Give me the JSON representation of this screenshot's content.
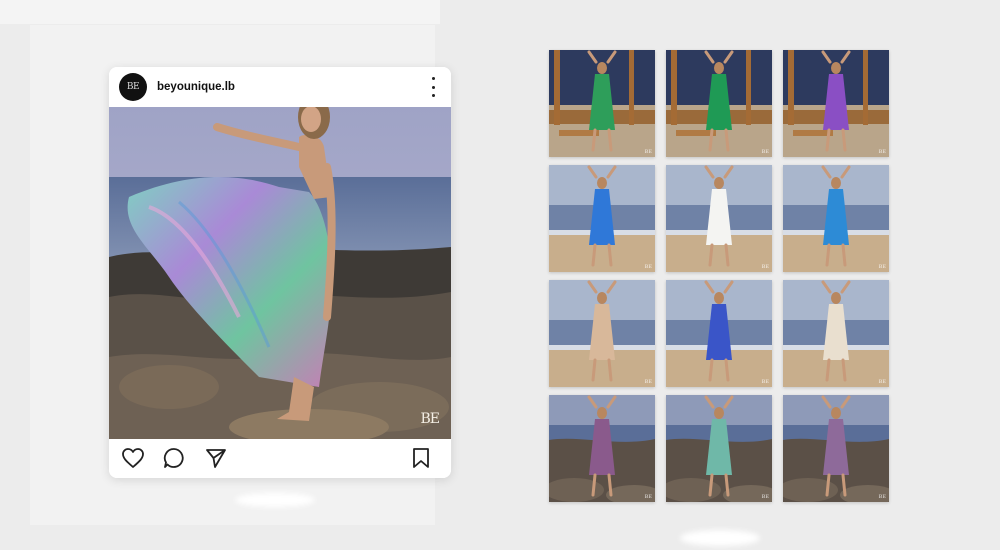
{
  "post": {
    "avatar_text": "BE",
    "username": "beyounique.lb",
    "watermark": "BE",
    "actions": [
      "heart-icon",
      "comment-icon",
      "share-icon",
      "bookmark-icon"
    ]
  },
  "grid": {
    "rows": 4,
    "columns": 3,
    "tiles": [
      {
        "scene": "bench",
        "outfit": "green floral jumpsuit",
        "color": "#2e9e5a"
      },
      {
        "scene": "bench",
        "outfit": "green dress",
        "color": "#1f9a55"
      },
      {
        "scene": "bench",
        "outfit": "purple top green pants",
        "color": "#8a4fc4"
      },
      {
        "scene": "beach",
        "outfit": "white top blue pants",
        "color": "#2f78d8"
      },
      {
        "scene": "beach",
        "outfit": "white dress",
        "color": "#f4f4f2"
      },
      {
        "scene": "beach",
        "outfit": "blue jumpsuit",
        "color": "#2d8bd6"
      },
      {
        "scene": "beach",
        "outfit": "blue top beige pants",
        "color": "#d8b89a"
      },
      {
        "scene": "beach",
        "outfit": "white top blue wide pants",
        "color": "#3a55c8"
      },
      {
        "scene": "beach",
        "outfit": "blue top white shorts",
        "color": "#e9dfcf"
      },
      {
        "scene": "rocks",
        "outfit": "purple maxi dress",
        "color": "#8a5a8c"
      },
      {
        "scene": "rocks",
        "outfit": "paisley flowing dress",
        "color": "#6fb8a8"
      },
      {
        "scene": "rocks",
        "outfit": "purple paisley dress",
        "color": "#8e6a9a"
      }
    ]
  }
}
